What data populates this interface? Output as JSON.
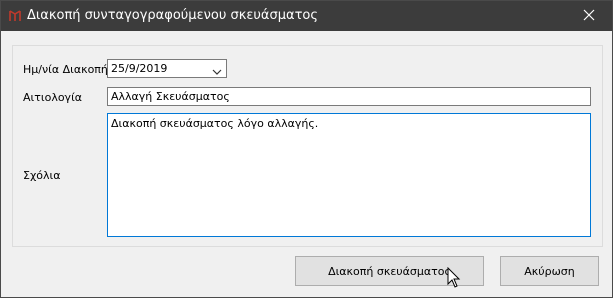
{
  "window": {
    "title": "Διακοπή συνταγογραφούμενου σκευάσματος"
  },
  "form": {
    "date_label": "Ημ/νία Διακοπής",
    "date_value": "25/9/2019",
    "reason_label": "Αιτιολογία",
    "reason_value": "Αλλαγή Σκευάσματος",
    "comments_label": "Σχόλια",
    "comments_value": "Διακοπή σκευάσματος λόγο αλλαγής."
  },
  "buttons": {
    "stop": "Διακοπή σκευάσματος",
    "cancel": "Ακύρωση"
  },
  "icons": {
    "app": "app-icon",
    "close": "close-icon",
    "dropdown": "chevron-down-icon",
    "cursor": "mouse-cursor-icon"
  }
}
